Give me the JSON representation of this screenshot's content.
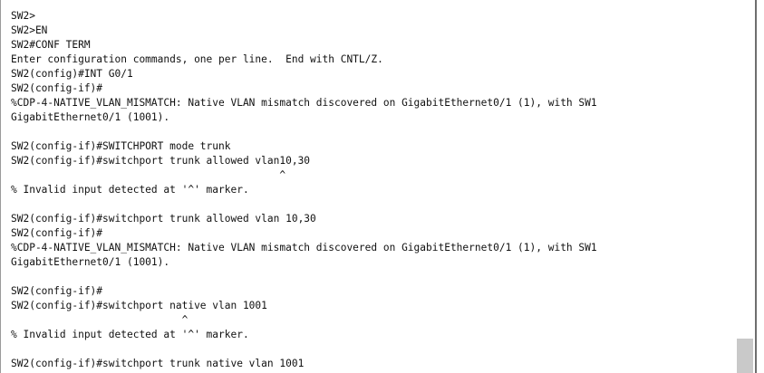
{
  "terminal": {
    "lines": [
      "SW2>",
      "SW2>EN",
      "SW2#CONF TERM",
      "Enter configuration commands, one per line.  End with CNTL/Z.",
      "SW2(config)#INT G0/1",
      "SW2(config-if)#",
      "%CDP-4-NATIVE_VLAN_MISMATCH: Native VLAN mismatch discovered on GigabitEthernet0/1 (1), with SW1",
      "GigabitEthernet0/1 (1001).",
      "",
      "SW2(config-if)#SWITCHPORT mode trunk",
      "SW2(config-if)#switchport trunk allowed vlan10,30",
      "                                            ^",
      "% Invalid input detected at '^' marker.",
      "",
      "SW2(config-if)#switchport trunk allowed vlan 10,30",
      "SW2(config-if)#",
      "%CDP-4-NATIVE_VLAN_MISMATCH: Native VLAN mismatch discovered on GigabitEthernet0/1 (1), with SW1",
      "GigabitEthernet0/1 (1001).",
      "",
      "SW2(config-if)#",
      "SW2(config-if)#switchport native vlan 1001",
      "                            ^",
      "% Invalid input detected at '^' marker.",
      "",
      "SW2(config-if)#switchport trunk native vlan 1001"
    ]
  },
  "scrollbar": {
    "position": "bottom"
  }
}
